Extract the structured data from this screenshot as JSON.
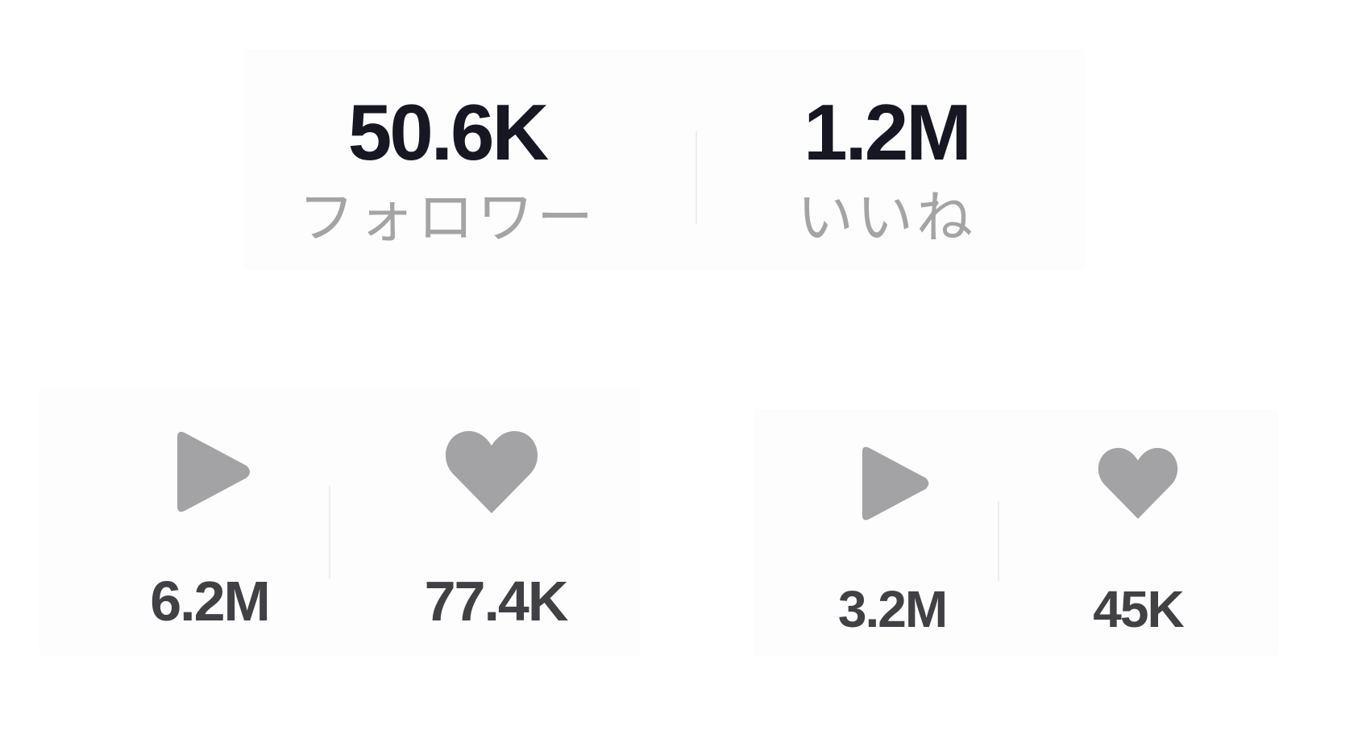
{
  "profile": {
    "followers": {
      "value": "50.6K",
      "label": "フォロワー"
    },
    "likes": {
      "value": "1.2M",
      "label": "いいね"
    }
  },
  "videos": [
    {
      "plays": "6.2M",
      "likes": "77.4K"
    },
    {
      "plays": "3.2M",
      "likes": "45K"
    }
  ],
  "colors": {
    "primary_text": "#161722",
    "secondary_text": "#a4a4a6",
    "metric_text": "#404045",
    "icon": "#a3a3a5"
  },
  "icons": {
    "plays": "play-icon",
    "likes": "heart-icon"
  }
}
